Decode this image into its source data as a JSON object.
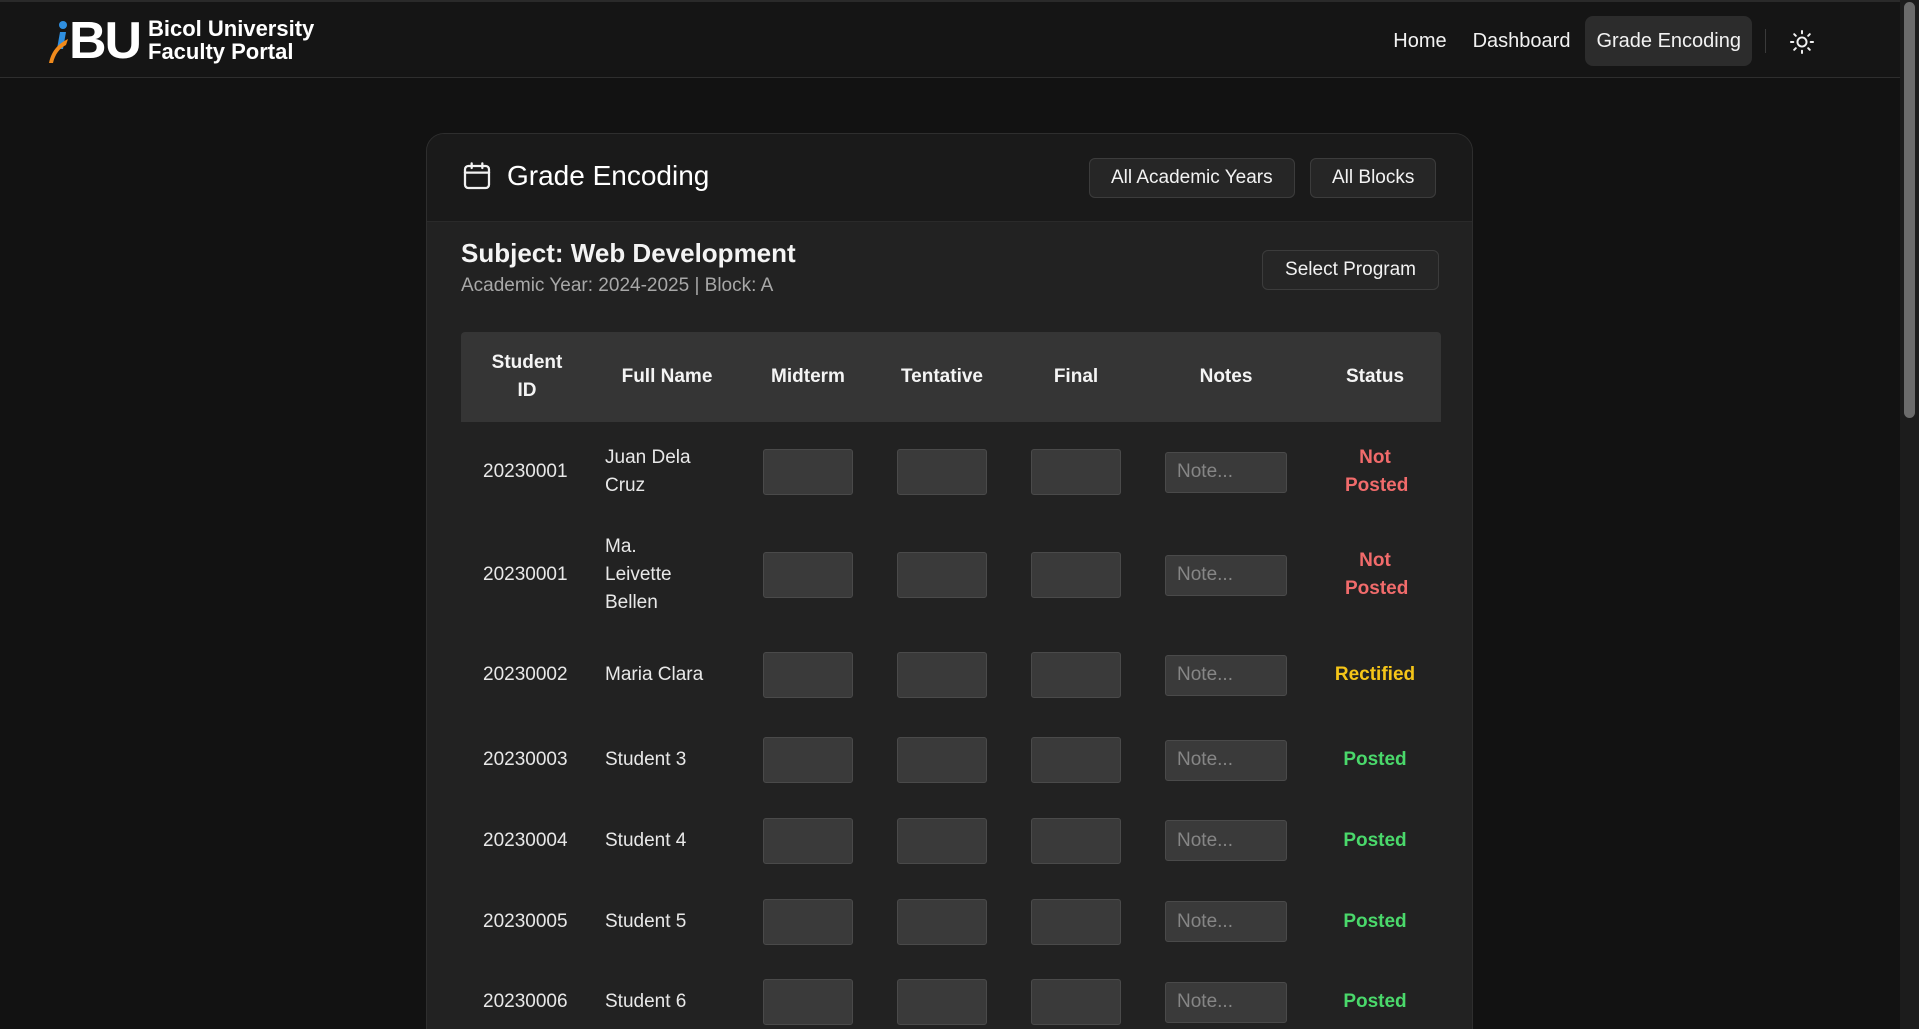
{
  "header": {
    "logo_text_line1": "Bicol University",
    "logo_text_line2": "Faculty Portal",
    "logo_mark": "BU",
    "nav": [
      {
        "label": "Home"
      },
      {
        "label": "Dashboard"
      },
      {
        "label": "Grade Encoding",
        "active": true
      }
    ],
    "theme_icon": "sun-icon"
  },
  "card": {
    "title": "Grade Encoding",
    "title_icon": "calendar-icon",
    "filters": {
      "academic_years": "All Academic Years",
      "blocks": "All Blocks"
    },
    "subject": "Subject: Web Development",
    "meta": "Academic Year: 2024-2025 | Block: A",
    "program_button": "Select Program"
  },
  "table": {
    "columns": [
      "Student ID",
      "Full Name",
      "Midterm",
      "Tentative",
      "Final",
      "Notes",
      "Status"
    ],
    "note_placeholder": "Note...",
    "rows": [
      {
        "id": "20230001",
        "name": "Juan Dela Cruz",
        "status": "Not Posted",
        "status_type": "not"
      },
      {
        "id": "20230001",
        "name": "Ma. Leivette Bellen",
        "status": "Not Posted",
        "status_type": "not"
      },
      {
        "id": "20230002",
        "name": "Maria Clara",
        "status": "Rectified",
        "status_type": "rect"
      },
      {
        "id": "20230003",
        "name": "Student 3",
        "status": "Posted",
        "status_type": "posted"
      },
      {
        "id": "20230004",
        "name": "Student 4",
        "status": "Posted",
        "status_type": "posted"
      },
      {
        "id": "20230005",
        "name": "Student 5",
        "status": "Posted",
        "status_type": "posted"
      },
      {
        "id": "20230006",
        "name": "Student 6",
        "status": "Posted",
        "status_type": "posted"
      }
    ]
  },
  "colors": {
    "background": "#121212",
    "not_posted": "#f16b6b",
    "rectified": "#f5c518",
    "posted": "#4ad86b"
  }
}
